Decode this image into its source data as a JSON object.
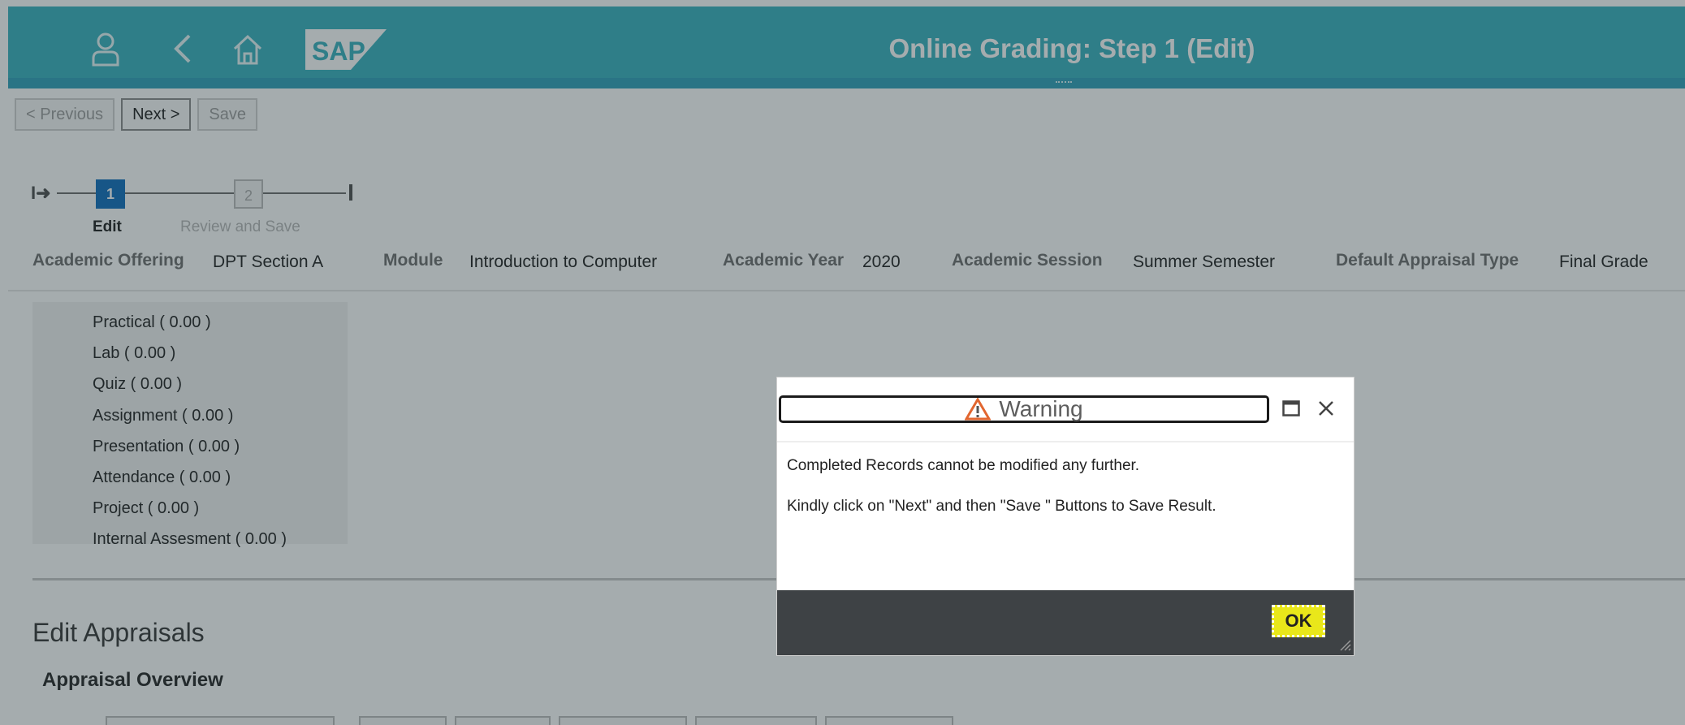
{
  "shell": {
    "title": "Online Grading: Step 1 (Edit)",
    "logo": "SAP",
    "icons": [
      "user-icon",
      "back-arrow-icon",
      "home-icon"
    ]
  },
  "toolbar": {
    "previous": "< Previous",
    "next": "Next >",
    "save": "Save"
  },
  "wizard": {
    "steps": [
      {
        "number": "1",
        "label": "Edit",
        "state": "active"
      },
      {
        "number": "2",
        "label": "Review and Save",
        "state": "inactive"
      }
    ]
  },
  "info": {
    "academic_offering_label": "Academic Offering",
    "academic_offering_value": "DPT Section A",
    "module_label": "Module",
    "module_value": "Introduction to Computer",
    "academic_year_label": "Academic Year",
    "academic_year_value": "2020",
    "academic_session_label": "Academic Session",
    "academic_session_value": "Summer Semester",
    "appraisal_type_label": "Default Appraisal Type",
    "appraisal_type_value": "Final Grade"
  },
  "weights": [
    "Practical ( 0.00 )",
    "Lab ( 0.00 )",
    "Quiz ( 0.00 )",
    "Assignment ( 0.00 )",
    "Presentation ( 0.00 )",
    "Attendance ( 0.00 )",
    "Project ( 0.00 )",
    "Internal Assesment ( 0.00 )"
  ],
  "sections": {
    "edit_appraisals": "Edit Appraisals",
    "appraisal_overview": "Appraisal Overview"
  },
  "dialog": {
    "title": "Warning",
    "line1": "Completed Records cannot be modified any further.",
    "line2": "Kindly click on \"Next\" and then \"Save \" Buttons to Save Result.",
    "ok_label": "OK"
  },
  "colors": {
    "shell": "#35b0bd",
    "wizard_active": "#0b6cbc",
    "ok_button": "#e9e71a",
    "dialog_footer": "#3e4245"
  }
}
